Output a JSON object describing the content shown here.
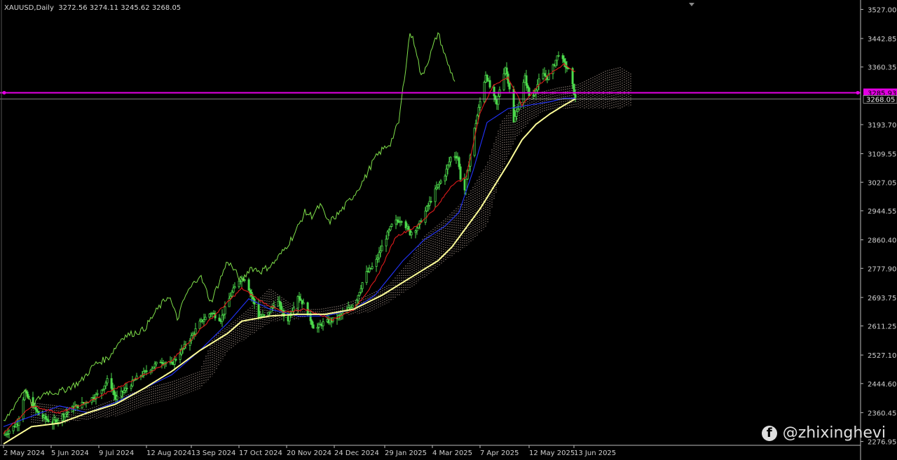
{
  "header": {
    "symbol": "XAUUSD,Daily",
    "ohlc": "3272.56 3274.11 3245.62 3268.05"
  },
  "watermark": {
    "icon": "facebook-icon",
    "handle": "@zhixinghevi"
  },
  "colors": {
    "background": "#000000",
    "candle": "#4cd94c",
    "tenkan": "#e01b1b",
    "kijun": "#2233ff",
    "chikou": "#7fe04a",
    "ma": "#ffff99",
    "cloud": "#f0d6c8",
    "hline": "#e400e4",
    "price_line": "#b0b0b0",
    "axis_text": "#d0d0d0"
  },
  "chart_data": {
    "type": "line",
    "title": "XAUUSD,Daily",
    "y_ticks": [
      "3527.00",
      "3442.85",
      "3360.35",
      "3193.70",
      "3109.55",
      "3027.05",
      "2944.55",
      "2860.40",
      "2777.90",
      "2693.75",
      "2611.25",
      "2527.10",
      "2444.60",
      "2360.45",
      "2276.95"
    ],
    "x_ticks": [
      "2 May 2024",
      "5 Jun 2024",
      "9 Jul 2024",
      "12 Aug 2024",
      "13 Sep 2024",
      "17 Oct 2024",
      "20 Nov 2024",
      "24 Dec 2024",
      "29 Jan 2025",
      "4 Mar 2025",
      "7 Apr 2025",
      "12 May 2025",
      "13 Jun 2025"
    ],
    "ylim": [
      2266,
      3538
    ],
    "horizontal_line": {
      "value": 3285.93,
      "label": "3285.93"
    },
    "current_price": {
      "value": 3268.05,
      "label": "3268.05"
    },
    "x_key_days": [
      0,
      34,
      68,
      102,
      134,
      168,
      202,
      236,
      272,
      306,
      340,
      375,
      407
    ],
    "total_days": 450,
    "close_anchors": [
      [
        0,
        2295
      ],
      [
        10,
        2330
      ],
      [
        15,
        2420
      ],
      [
        25,
        2355
      ],
      [
        35,
        2330
      ],
      [
        48,
        2370
      ],
      [
        58,
        2390
      ],
      [
        68,
        2415
      ],
      [
        75,
        2460
      ],
      [
        80,
        2400
      ],
      [
        95,
        2460
      ],
      [
        102,
        2480
      ],
      [
        112,
        2510
      ],
      [
        120,
        2500
      ],
      [
        134,
        2580
      ],
      [
        140,
        2620
      ],
      [
        148,
        2650
      ],
      [
        155,
        2630
      ],
      [
        162,
        2700
      ],
      [
        168,
        2745
      ],
      [
        172,
        2750
      ],
      [
        176,
        2710
      ],
      [
        182,
        2640
      ],
      [
        188,
        2640
      ],
      [
        195,
        2690
      ],
      [
        202,
        2620
      ],
      [
        210,
        2700
      ],
      [
        216,
        2660
      ],
      [
        222,
        2600
      ],
      [
        228,
        2620
      ],
      [
        236,
        2630
      ],
      [
        244,
        2650
      ],
      [
        252,
        2690
      ],
      [
        258,
        2760
      ],
      [
        265,
        2790
      ],
      [
        272,
        2860
      ],
      [
        278,
        2910
      ],
      [
        284,
        2920
      ],
      [
        290,
        2880
      ],
      [
        296,
        2900
      ],
      [
        303,
        2960
      ],
      [
        309,
        3010
      ],
      [
        315,
        3050
      ],
      [
        320,
        3110
      ],
      [
        324,
        3100
      ],
      [
        328,
        2980
      ],
      [
        332,
        3080
      ],
      [
        336,
        3180
      ],
      [
        340,
        3260
      ],
      [
        344,
        3340
      ],
      [
        348,
        3290
      ],
      [
        352,
        3250
      ],
      [
        355,
        3320
      ],
      [
        358,
        3360
      ],
      [
        361,
        3300
      ],
      [
        364,
        3200
      ],
      [
        368,
        3260
      ],
      [
        372,
        3330
      ],
      [
        376,
        3260
      ],
      [
        380,
        3300
      ],
      [
        384,
        3340
      ],
      [
        388,
        3330
      ],
      [
        392,
        3360
      ],
      [
        396,
        3400
      ],
      [
        400,
        3370
      ],
      [
        404,
        3345
      ],
      [
        406,
        3305
      ],
      [
        408,
        3268
      ]
    ],
    "ma_anchors": [
      [
        0,
        2270
      ],
      [
        20,
        2320
      ],
      [
        40,
        2330
      ],
      [
        60,
        2360
      ],
      [
        80,
        2385
      ],
      [
        100,
        2430
      ],
      [
        120,
        2480
      ],
      [
        140,
        2540
      ],
      [
        160,
        2590
      ],
      [
        170,
        2625
      ],
      [
        190,
        2640
      ],
      [
        210,
        2645
      ],
      [
        230,
        2645
      ],
      [
        250,
        2660
      ],
      [
        270,
        2700
      ],
      [
        290,
        2750
      ],
      [
        310,
        2800
      ],
      [
        320,
        2840
      ],
      [
        340,
        2950
      ],
      [
        360,
        3080
      ],
      [
        370,
        3150
      ],
      [
        380,
        3195
      ],
      [
        390,
        3225
      ],
      [
        400,
        3250
      ],
      [
        408,
        3268
      ]
    ],
    "tenkan_anchors": [
      [
        0,
        2300
      ],
      [
        20,
        2380
      ],
      [
        40,
        2360
      ],
      [
        60,
        2390
      ],
      [
        80,
        2430
      ],
      [
        100,
        2470
      ],
      [
        120,
        2510
      ],
      [
        140,
        2600
      ],
      [
        160,
        2680
      ],
      [
        170,
        2720
      ],
      [
        185,
        2680
      ],
      [
        200,
        2650
      ],
      [
        215,
        2660
      ],
      [
        235,
        2630
      ],
      [
        250,
        2660
      ],
      [
        265,
        2740
      ],
      [
        280,
        2870
      ],
      [
        295,
        2900
      ],
      [
        310,
        2960
      ],
      [
        320,
        3020
      ],
      [
        330,
        3040
      ],
      [
        340,
        3230
      ],
      [
        350,
        3310
      ],
      [
        360,
        3330
      ],
      [
        370,
        3250
      ],
      [
        380,
        3300
      ],
      [
        390,
        3340
      ],
      [
        400,
        3370
      ],
      [
        408,
        3345
      ]
    ],
    "kijun_anchors": [
      [
        0,
        2320
      ],
      [
        20,
        2350
      ],
      [
        40,
        2380
      ],
      [
        60,
        2360
      ],
      [
        80,
        2390
      ],
      [
        100,
        2430
      ],
      [
        120,
        2470
      ],
      [
        140,
        2540
      ],
      [
        160,
        2620
      ],
      [
        175,
        2690
      ],
      [
        190,
        2660
      ],
      [
        210,
        2640
      ],
      [
        230,
        2640
      ],
      [
        250,
        2660
      ],
      [
        265,
        2700
      ],
      [
        285,
        2800
      ],
      [
        300,
        2860
      ],
      [
        315,
        2900
      ],
      [
        325,
        2940
      ],
      [
        335,
        3060
      ],
      [
        345,
        3200
      ],
      [
        360,
        3240
      ],
      [
        375,
        3250
      ],
      [
        390,
        3260
      ],
      [
        400,
        3270
      ],
      [
        408,
        3270
      ]
    ],
    "chikou_anchors": [
      [
        0,
        2330
      ],
      [
        15,
        2430
      ],
      [
        20,
        2380
      ],
      [
        30,
        2420
      ],
      [
        40,
        2420
      ],
      [
        55,
        2450
      ],
      [
        65,
        2500
      ],
      [
        75,
        2520
      ],
      [
        85,
        2580
      ],
      [
        100,
        2600
      ],
      [
        110,
        2660
      ],
      [
        118,
        2700
      ],
      [
        124,
        2630
      ],
      [
        130,
        2700
      ],
      [
        140,
        2760
      ],
      [
        148,
        2680
      ],
      [
        154,
        2740
      ],
      [
        160,
        2800
      ],
      [
        170,
        2740
      ],
      [
        176,
        2780
      ],
      [
        184,
        2770
      ],
      [
        192,
        2790
      ],
      [
        200,
        2830
      ],
      [
        208,
        2880
      ],
      [
        215,
        2940
      ],
      [
        220,
        2930
      ],
      [
        226,
        2960
      ],
      [
        232,
        2910
      ],
      [
        240,
        2940
      ],
      [
        250,
        2990
      ],
      [
        258,
        3040
      ],
      [
        264,
        3090
      ],
      [
        270,
        3120
      ],
      [
        276,
        3140
      ],
      [
        282,
        3200
      ],
      [
        286,
        3330
      ],
      [
        290,
        3460
      ],
      [
        294,
        3420
      ],
      [
        298,
        3330
      ],
      [
        304,
        3390
      ],
      [
        310,
        3460
      ],
      [
        316,
        3380
      ],
      [
        322,
        3320
      ]
    ],
    "cloud_upper_anchors": [
      [
        20,
        2390
      ],
      [
        40,
        2380
      ],
      [
        60,
        2370
      ],
      [
        80,
        2400
      ],
      [
        100,
        2430
      ],
      [
        120,
        2450
      ],
      [
        140,
        2480
      ],
      [
        150,
        2580
      ],
      [
        160,
        2610
      ],
      [
        175,
        2660
      ],
      [
        190,
        2720
      ],
      [
        200,
        2690
      ],
      [
        210,
        2660
      ],
      [
        225,
        2660
      ],
      [
        240,
        2670
      ],
      [
        260,
        2700
      ],
      [
        275,
        2730
      ],
      [
        290,
        2800
      ],
      [
        300,
        2870
      ],
      [
        315,
        2920
      ],
      [
        330,
        2980
      ],
      [
        345,
        3080
      ],
      [
        355,
        3200
      ],
      [
        365,
        3250
      ],
      [
        375,
        3270
      ],
      [
        385,
        3290
      ],
      [
        395,
        3300
      ],
      [
        410,
        3310
      ],
      [
        420,
        3330
      ],
      [
        430,
        3350
      ],
      [
        440,
        3360
      ],
      [
        448,
        3340
      ]
    ],
    "cloud_lower_anchors": [
      [
        20,
        2330
      ],
      [
        40,
        2330
      ],
      [
        60,
        2340
      ],
      [
        80,
        2350
      ],
      [
        100,
        2380
      ],
      [
        120,
        2400
      ],
      [
        140,
        2430
      ],
      [
        150,
        2470
      ],
      [
        160,
        2540
      ],
      [
        175,
        2580
      ],
      [
        190,
        2620
      ],
      [
        200,
        2630
      ],
      [
        210,
        2630
      ],
      [
        225,
        2650
      ],
      [
        240,
        2640
      ],
      [
        260,
        2650
      ],
      [
        275,
        2680
      ],
      [
        290,
        2720
      ],
      [
        300,
        2750
      ],
      [
        315,
        2800
      ],
      [
        330,
        2840
      ],
      [
        345,
        2900
      ],
      [
        355,
        3050
      ],
      [
        365,
        3150
      ],
      [
        375,
        3200
      ],
      [
        385,
        3230
      ],
      [
        395,
        3240
      ],
      [
        410,
        3240
      ],
      [
        420,
        3240
      ],
      [
        430,
        3240
      ],
      [
        440,
        3240
      ],
      [
        448,
        3250
      ]
    ]
  }
}
